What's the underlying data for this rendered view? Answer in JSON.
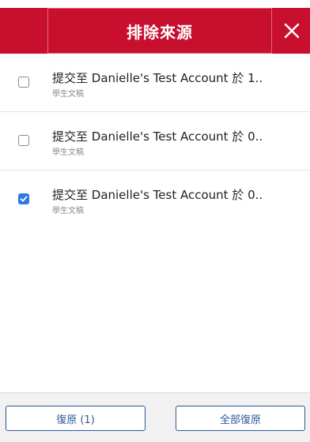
{
  "header": {
    "title": "排除來源",
    "close_icon": "close-icon",
    "accent_color": "#c8102e"
  },
  "sources": [
    {
      "title": "提交至 Danielle's Test Account 於 1..",
      "subtitle": "學生文稿",
      "checked": false
    },
    {
      "title": "提交至 Danielle's Test Account 於 0..",
      "subtitle": "學生文稿",
      "checked": false
    },
    {
      "title": "提交至 Danielle's Test Account 於 0..",
      "subtitle": "學生文稿",
      "checked": true
    }
  ],
  "footer": {
    "restore_label": "復原 (1)",
    "restore_all_label": "全部復原"
  }
}
